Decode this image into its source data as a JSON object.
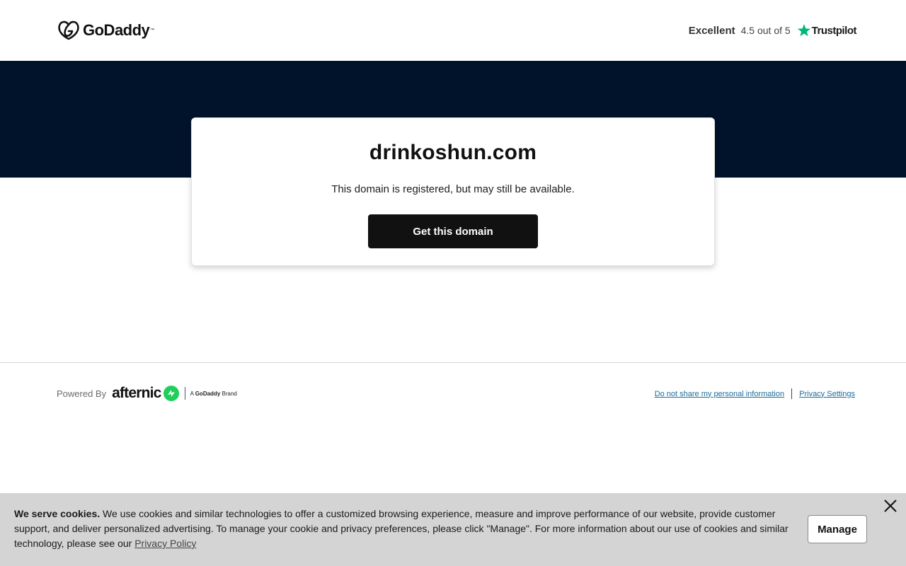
{
  "header": {
    "logo_text": "GoDaddy",
    "logo_tm": "™",
    "rating_word": "Excellent",
    "rating_score": "4.5 out of 5",
    "trustpilot_label": "Trustpilot",
    "icons": {
      "logo": "godaddy-logo-icon",
      "star": "trustpilot-star-icon"
    },
    "colors": {
      "trustpilot_green": "#00b67a"
    }
  },
  "hero": {
    "band_color": "#00132b"
  },
  "card": {
    "domain": "drinkoshun.com",
    "status": "This domain is registered, but may still be available.",
    "cta_label": "Get this domain"
  },
  "footer": {
    "powered_by": "Powered By",
    "afternic": "afternic",
    "brand_tag_prefix": "A",
    "brand_tag_name": "GoDaddy",
    "brand_tag_suffix": "Brand",
    "links": [
      "Do not share my personal information",
      "Privacy Settings"
    ],
    "colors": {
      "link": "#1b6e9a",
      "afternic_green": "#1fcf5a"
    }
  },
  "cookie": {
    "title": "We serve cookies.",
    "body": " We use cookies and similar technologies to offer a customized browsing experience, measure and improve performance of our website, provide customer support, and deliver personalized advertising. To manage your cookie and privacy preferences, please click \"Manage\". For more information about our use of cookies and similar technology, please see our ",
    "policy_link": "Privacy Policy",
    "manage_label": "Manage",
    "close_icon": "close-icon"
  }
}
